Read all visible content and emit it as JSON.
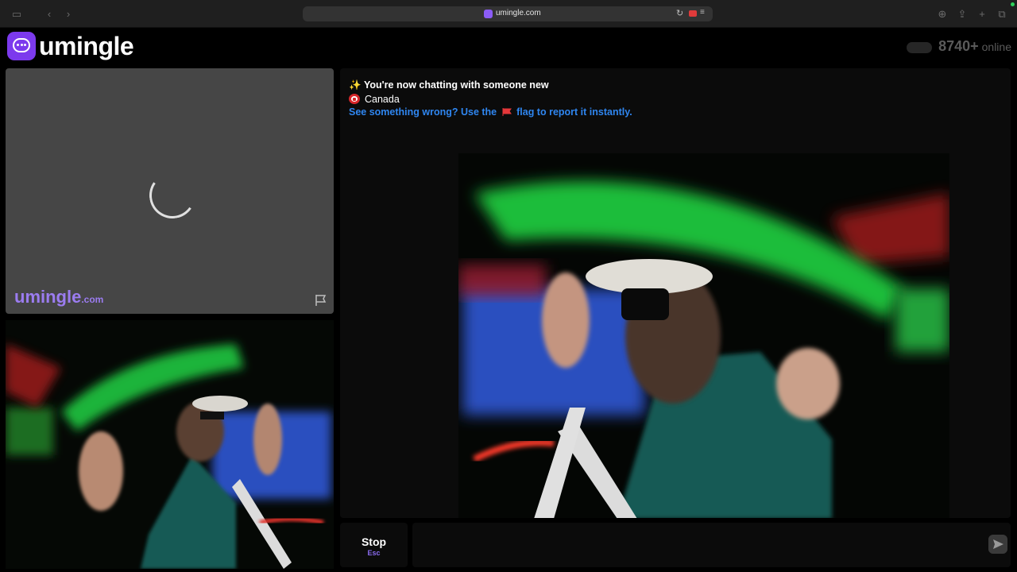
{
  "browser": {
    "url": "umingle.com",
    "icons": [
      "sidebar-icon",
      "back-icon",
      "forward-icon",
      "reload-icon",
      "camera-recording-icon",
      "reader-icon",
      "download-icon",
      "share-icon",
      "new-tab-icon",
      "tabs-overview-icon"
    ]
  },
  "header": {
    "logo_text": "umingle",
    "online_count": "8740+",
    "online_label": "online"
  },
  "self_panel": {
    "watermark_main": "umingle",
    "watermark_suffix": ".com"
  },
  "chat": {
    "new_chat_message": "You're now chatting with someone new",
    "country": "Canada",
    "report_hint_before": "See something wrong? Use the",
    "report_hint_after": "flag to report it instantly."
  },
  "controls": {
    "stop_label": "Stop",
    "stop_shortcut": "Esc",
    "message_placeholder": ""
  },
  "colors": {
    "brand": "#7c3aed",
    "link": "#2f86f0",
    "panel": "#0b0b0b"
  }
}
